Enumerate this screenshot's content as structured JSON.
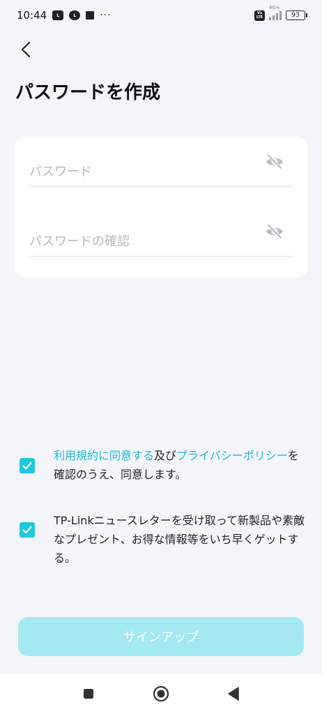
{
  "status_bar": {
    "time": "10:44",
    "notification_icons": [
      "line-badge-icon",
      "line-icon",
      "storage-icon"
    ],
    "more": "···",
    "volte_label": "Vo LTE",
    "network_type": "4G+",
    "battery_level": "93"
  },
  "header": {
    "title": "パスワードを作成"
  },
  "form": {
    "password_placeholder": "パスワード",
    "confirm_placeholder": "パスワードの確認"
  },
  "agreements": {
    "terms_link": "利用規約に同意する",
    "and_text": "及び",
    "privacy_link": "プライバシーポリシー",
    "confirm_text": "を確認のうえ、同意します。",
    "newsletter_text": "TP-Linkニュースレターを受け取って新製品や素敵なプレゼント、お得な情報等をいち早くゲットする。",
    "terms_checked": true,
    "newsletter_checked": true
  },
  "signup": {
    "label": "サインアップ"
  },
  "colors": {
    "accent": "#1ec8de",
    "link": "#1fb8d4",
    "button_disabled": "#a4e8f2",
    "background": "#f4f5fa"
  }
}
